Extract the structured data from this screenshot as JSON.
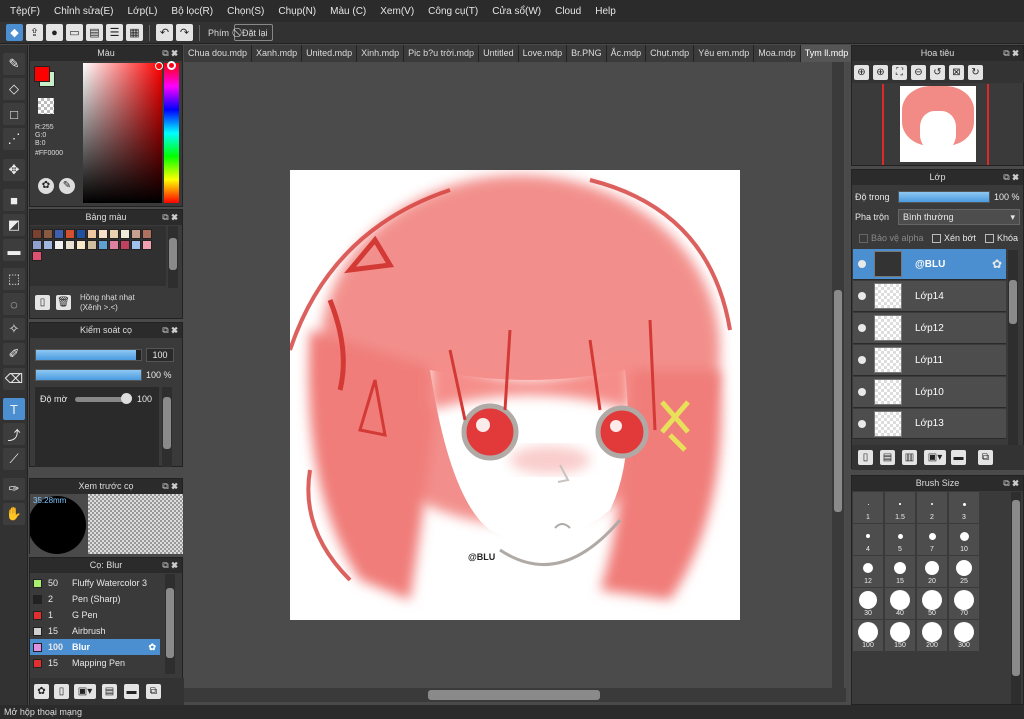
{
  "menu": [
    "Tệp(F)",
    "Chỉnh sửa(E)",
    "Lớp(L)",
    "Bộ lọc(R)",
    "Chọn(S)",
    "Chụp(N)",
    "Màu (C)",
    "Xem(V)",
    "Công cụ(T)",
    "Cửa sổ(W)",
    "Cloud",
    "Help"
  ],
  "toolbar": {
    "phim_label": "Phím",
    "reset_label": "Đặt lại"
  },
  "color_panel": {
    "title": "Màu",
    "r": "R:255",
    "g": "G:0",
    "b": "B:0",
    "hex": "#FF0000",
    "primary_color": "#ff0000",
    "secondary_color": "#c8f0c8"
  },
  "palette_panel": {
    "title": "Bảng màu",
    "palette_name": "Hồng nhạt nhạt",
    "palette_sub": "(Xênh >.<)",
    "colors": [
      "#7a4030",
      "#8a5a40",
      "#3f5fb0",
      "#d05030",
      "#2050a0",
      "#f0c8a0",
      "#f8e0c8",
      "#e8d0b0",
      "#f0e8d8",
      "#c8a090",
      "#b07060",
      "#90a0d0",
      "#a0b8e0",
      "#f0f0f0",
      "#e8e0d0",
      "#f8e8c8",
      "#d0c0a0",
      "#60a0d0",
      "#e080a0",
      "#c04060",
      "#a0c0f0",
      "#f0a0b0",
      "#e05070"
    ]
  },
  "brush_control": {
    "title": "Kiểm soát cọ",
    "size_value": "100",
    "opacity_value": "100 %",
    "blur_label": "Độ mờ",
    "blur_value": "100",
    "size_fraction": 0.95,
    "opacity_fraction": 1.0
  },
  "brush_preview": {
    "title": "Xem trước cọ",
    "size_label": "35.28mm"
  },
  "brush_list": {
    "title": "Cọ: Blur",
    "items": [
      {
        "size": "50",
        "name": "Fluffy Watercolor 3",
        "color": "#a8f070"
      },
      {
        "size": "2",
        "name": "Pen (Sharp)",
        "color": "#222222"
      },
      {
        "size": "1",
        "name": "G Pen",
        "color": "#e03030"
      },
      {
        "size": "15",
        "name": "Airbrush",
        "color": "#d0d0d0"
      },
      {
        "size": "100",
        "name": "Blur",
        "color": "#e090e0"
      },
      {
        "size": "15",
        "name": "Mapping Pen",
        "color": "#e03030"
      }
    ]
  },
  "tabs": [
    "Chua dou.mdp",
    "Xanh.mdp",
    "United.mdp",
    "Xinh.mdp",
    "Pic b?u trời.mdp",
    "Untitled",
    "Love.mdp",
    "Br.PNG",
    "Ắc.mdp",
    "Chụt.mdp",
    "Yêu em.mdp",
    "Moa.mdp",
    "Tym ll.mdp"
  ],
  "canvas": {
    "watermark": "@BLU"
  },
  "navigator": {
    "title": "Hoa tiêu"
  },
  "layer_panel": {
    "title": "Lớp",
    "opacity_label": "Độ trong",
    "opacity_value": "100 %",
    "opacity_fraction": 1.0,
    "blend_label": "Pha trộn",
    "blend_value": "Bình thường",
    "protect_alpha": "Bảo vệ alpha",
    "clipping": "Xén bớt",
    "lock": "Khóa",
    "layers": [
      "@BLU",
      "Lớp14",
      "Lớp12",
      "Lớp11",
      "Lớp10",
      "Lớp13"
    ]
  },
  "brush_size": {
    "title": "Brush Size",
    "sizes": [
      "1",
      "1.5",
      "2",
      "3",
      "4",
      "5",
      "7",
      "10",
      "12",
      "15",
      "20",
      "25",
      "30",
      "40",
      "50",
      "70",
      "100",
      "150",
      "200",
      "300"
    ]
  },
  "status": "Mở hộp thoại mạng"
}
